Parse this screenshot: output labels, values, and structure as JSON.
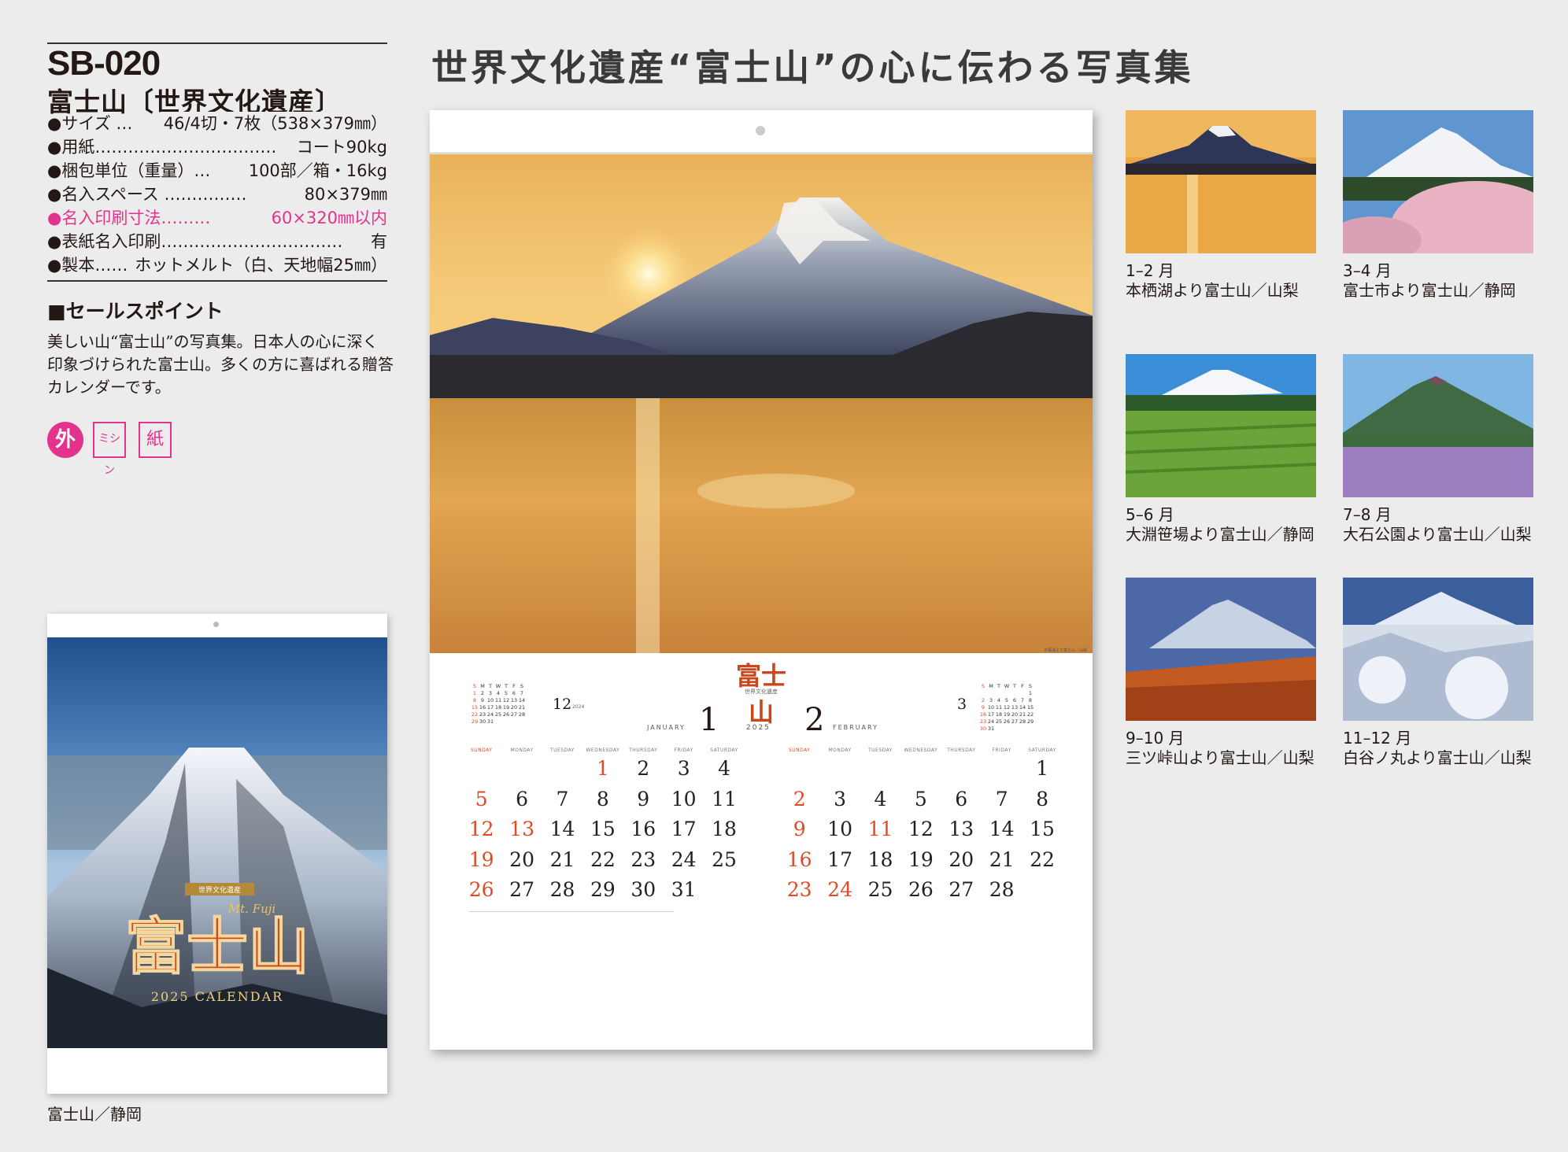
{
  "product": {
    "code": "SB-020",
    "name": "富士山〔世界文化遺産〕",
    "specs": [
      {
        "label": "●サイズ …",
        "value": "46/4切・7枚（538×379㎜）"
      },
      {
        "label": "●用紙……………………………",
        "value": "コート90kg"
      },
      {
        "label": "●梱包単位（重量）…",
        "value": "100部／箱・16kg"
      },
      {
        "label": "●名入スペース ……………",
        "value": "80×379㎜"
      },
      {
        "label": "●名入印刷寸法………",
        "value": "60×320㎜以内"
      },
      {
        "label": "●表紙名入印刷……………………………",
        "value": "有"
      },
      {
        "label": "●製本……",
        "value": "ホットメルト（白、天地幅25㎜）"
      }
    ],
    "sales_point_title": "■セールスポイント",
    "sales_point_text": "美しい山“富士山”の写真集。日本人の心に深く印象づけられた富士山。多くの方に喜ばれる贈答カレンダーです。",
    "badges": [
      "外",
      "ミシン",
      "紙"
    ]
  },
  "cover": {
    "series": "世界文化遺産",
    "subtitle": "Mt. Fuji",
    "title": "富士山",
    "footer": "2025 CALENDAR",
    "caption": "富士山／静岡"
  },
  "headline": "世界文化遺産“富士山”の心に伝わる写真集",
  "calendar": {
    "logo": "富士山",
    "logo_sub": "世界文化遺産",
    "year": "2025",
    "year_prev": "2024",
    "weekdays": [
      "SUNDAY",
      "MONDAY",
      "TUESDAY",
      "WEDNESDAY",
      "THURSDAY",
      "FRIDAY",
      "SATURDAY"
    ],
    "months": [
      {
        "num": "1",
        "name": "JANUARY",
        "start": 3,
        "days": 31,
        "red": [
          1,
          5,
          12,
          13,
          19,
          26
        ]
      },
      {
        "num": "2",
        "name": "FEBRUARY",
        "start": 6,
        "days": 28,
        "red": [
          2,
          9,
          11,
          16,
          23,
          24
        ]
      }
    ],
    "mini_prev": {
      "num": "12",
      "year": "2024",
      "start": 0,
      "days": 31
    },
    "mini_next": {
      "num": "3",
      "start": 6,
      "days": 31
    }
  },
  "thumbnails": [
    {
      "months": "1–2 月",
      "caption": "本栖湖より富士山／山梨"
    },
    {
      "months": "3–4 月",
      "caption": "富士市より富士山／静岡"
    },
    {
      "months": "5–6 月",
      "caption": "大淵笹場より富士山／静岡"
    },
    {
      "months": "7–8 月",
      "caption": "大石公園より富士山／山梨"
    },
    {
      "months": "9–10 月",
      "caption": "三ツ峠山より富士山／山梨"
    },
    {
      "months": "11–12 月",
      "caption": "白谷ノ丸より富士山／山梨"
    }
  ],
  "colors": {
    "accent_pink": "#e4338c",
    "holiday_red": "#e04a25",
    "title_red": "#c8481e"
  }
}
